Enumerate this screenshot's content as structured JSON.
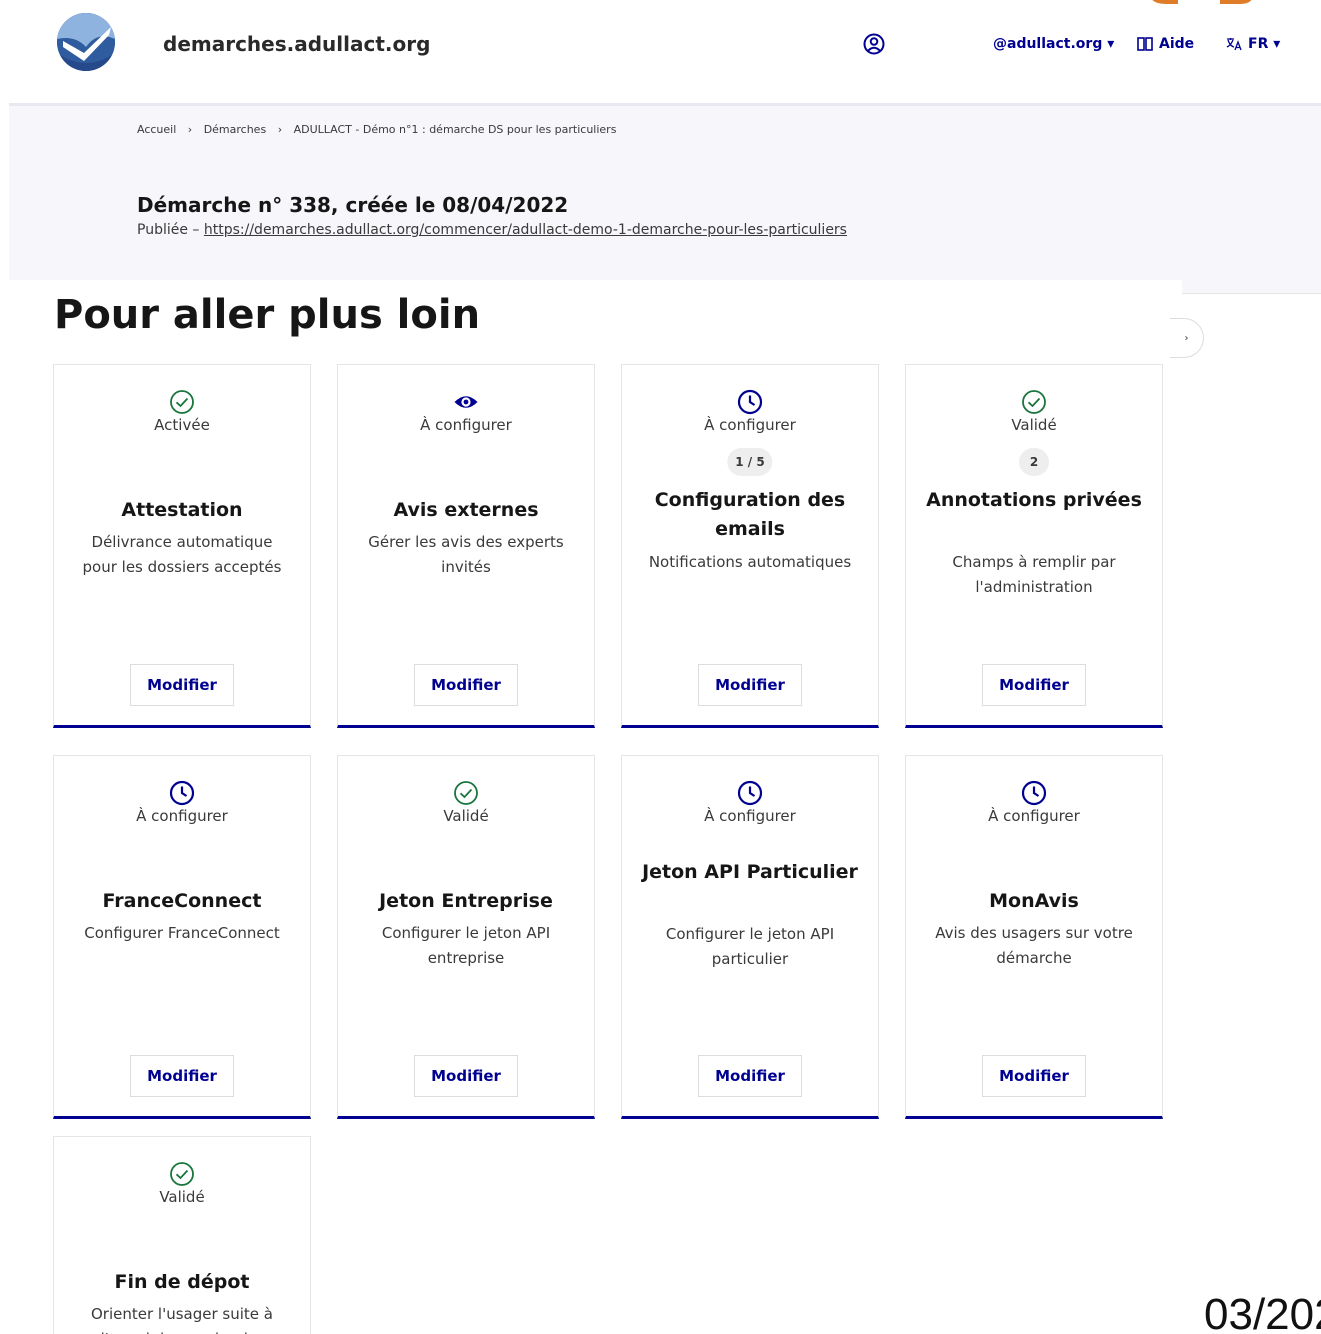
{
  "header": {
    "site_name": "demarches.adullact.org",
    "org_menu": "@adullact.org ▾",
    "help_label": "Aide",
    "lang_label": "FR ▾"
  },
  "breadcrumb": {
    "items": [
      "Accueil",
      "Démarches",
      "ADULLACT - Démo n°1 : démarche DS pour les particuliers"
    ],
    "separator": "›"
  },
  "procedure": {
    "title": "Démarche n° 338, créée le 08/04/2022",
    "status_prefix": "Publiée – ",
    "url": "https://demarches.adullact.org/commencer/adullact-demo-1-demarche-pour-les-particuliers"
  },
  "section_title": "Pour aller plus loin",
  "modify_label": "Modifier",
  "colors": {
    "accent": "#000091",
    "success": "#18753c",
    "neutral_badge": "#eeeeee"
  },
  "cards": [
    {
      "status": "Activée",
      "icon": "check-circle-icon",
      "badge": "",
      "title": "Attestation",
      "description": "Délivrance automatique pour les dossiers acceptés"
    },
    {
      "status": "À configurer",
      "icon": "eye-icon",
      "badge": "",
      "title": "Avis externes",
      "description": "Gérer les avis des experts invités"
    },
    {
      "status": "À configurer",
      "icon": "clock-icon",
      "badge": "1 / 5",
      "title": "Configuration des emails",
      "description": "Notifications automatiques"
    },
    {
      "status": "Validé",
      "icon": "check-circle-icon",
      "badge": "2",
      "title": "Annotations privées",
      "description": "Champs à remplir par l'administration"
    },
    {
      "status": "À configurer",
      "icon": "clock-icon",
      "badge": "",
      "title": "FranceConnect",
      "description": "Configurer FranceConnect"
    },
    {
      "status": "Validé",
      "icon": "check-circle-icon",
      "badge": "",
      "title": "Jeton Entreprise",
      "description": "Configurer le jeton API entreprise"
    },
    {
      "status": "À configurer",
      "icon": "clock-icon",
      "badge": "",
      "title": "Jeton API Particulier",
      "description": "Configurer le jeton API particulier"
    },
    {
      "status": "À configurer",
      "icon": "clock-icon",
      "badge": "",
      "title": "MonAvis",
      "description": "Avis des usagers sur votre démarche"
    },
    {
      "status": "Validé",
      "icon": "check-circle-icon",
      "badge": "",
      "title": "Fin de dépot",
      "description": "Orienter l'usager suite à l'envoi de son dossier"
    }
  ],
  "footer_date_fragment": "03/202"
}
